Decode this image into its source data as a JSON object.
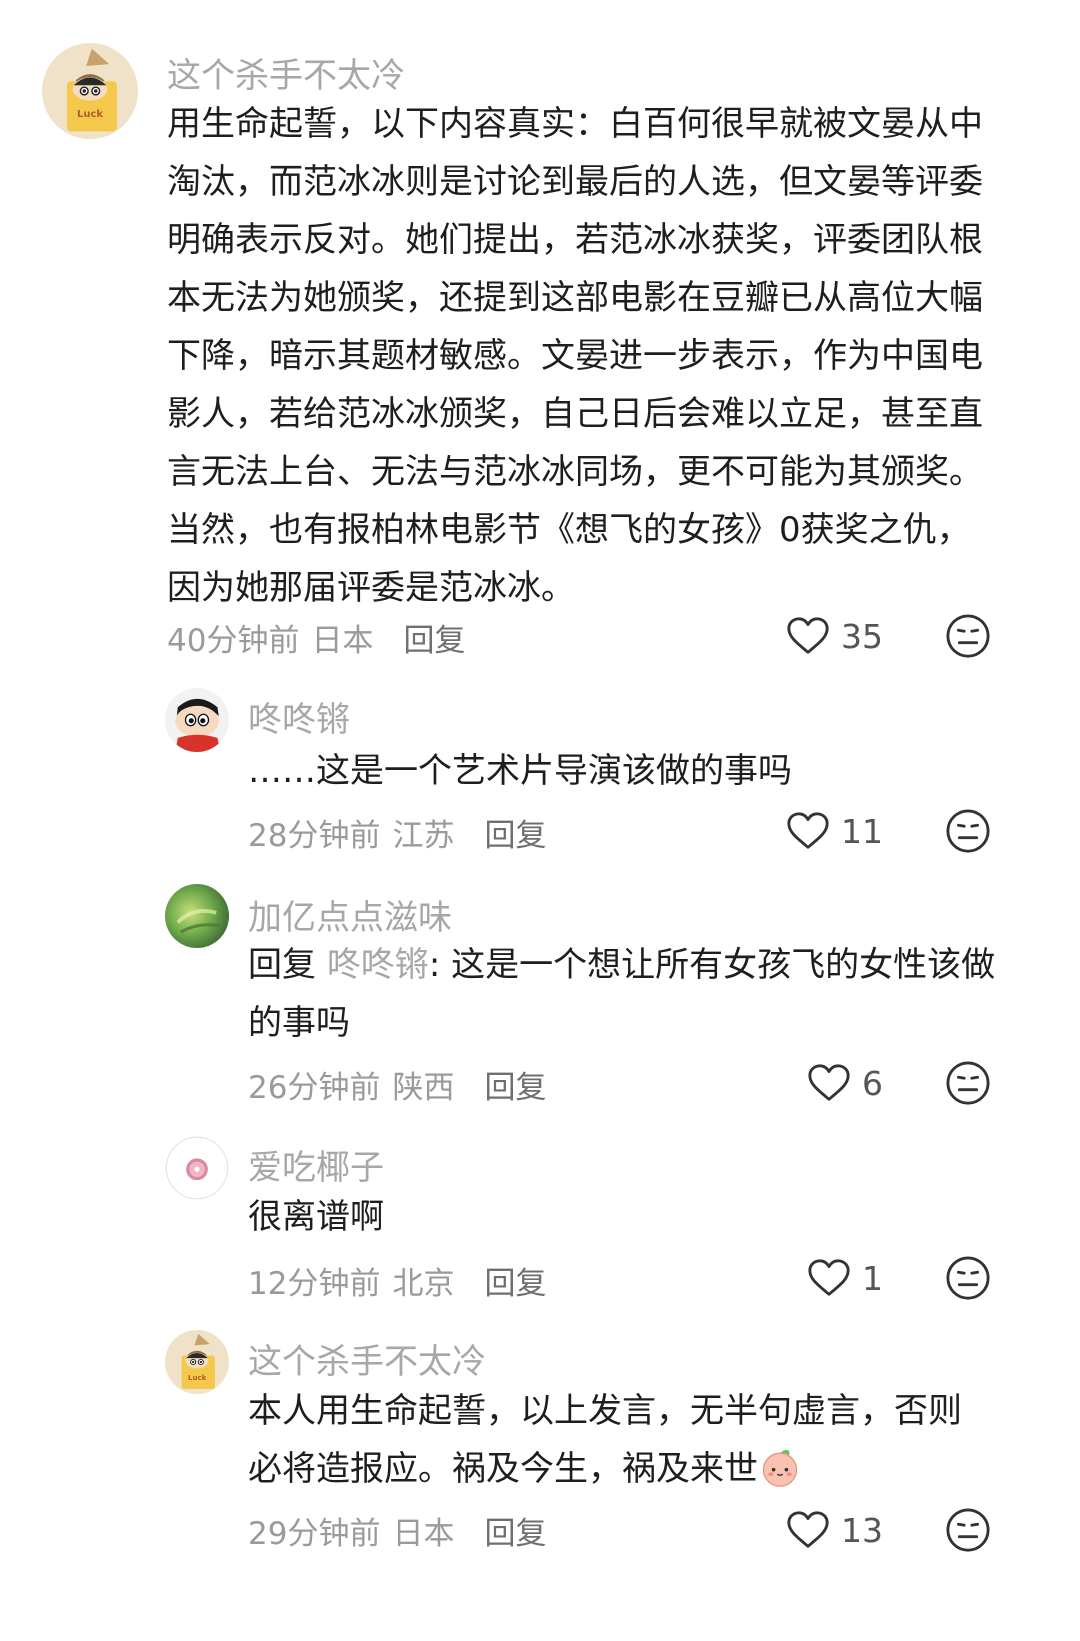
{
  "comments": [
    {
      "username": "这个杀手不太冷",
      "content": "用生命起誓，以下内容真实：白百何很早就被文晏从中淘汰，而范冰冰则是讨论到最后的人选，但文晏等评委明确表示反对。她们提出，若范冰冰获奖，评委团队根本无法为她颁奖，还提到这部电影在豆瓣已从高位大幅下降，暗示其题材敏感。文晏进一步表示，作为中国电影人，若给范冰冰颁奖，自己日后会难以立足，甚至直言无法上台、无法与范冰冰同场，更不可能为其颁奖。当然，也有报柏林电影节《想飞的女孩》0获奖之仇，因为她那届评委是范冰冰。",
      "time": "40分钟前",
      "location": "日本",
      "reply_label": "回复",
      "likes": "35",
      "avatar_icon": "crayon-shin-chan-bag-avatar",
      "avatar_bag_text": "Luck"
    }
  ],
  "replies": [
    {
      "username": "咚咚锵",
      "content": "……这是一个艺术片导演该做的事吗",
      "time": "28分钟前",
      "location": "江苏",
      "reply_label": "回复",
      "likes": "11",
      "avatar_icon": "crayon-shin-chan-avatar"
    },
    {
      "username": "加亿点点滋味",
      "reply_prefix": "回复 ",
      "reply_to": "咚咚锵",
      "content": ": 这是一个想让所有女孩飞的女性该做的事吗",
      "time": "26分钟前",
      "location": "陕西",
      "reply_label": "回复",
      "likes": "6",
      "avatar_icon": "green-plant-avatar"
    },
    {
      "username": "爱吃椰子",
      "content": "很离谱啊",
      "time": "12分钟前",
      "location": "北京",
      "reply_label": "回复",
      "likes": "1",
      "avatar_icon": "pink-donut-avatar"
    },
    {
      "username": "这个杀手不太冷",
      "content": "本人用生命起誓，以上发言，无半句虚言，否则必将造报应。祸及今生，祸及来世",
      "emoji": "peach-face-emoji",
      "time": "29分钟前",
      "location": "日本",
      "reply_label": "回复",
      "likes": "13",
      "avatar_icon": "crayon-shin-chan-bag-avatar",
      "avatar_bag_text": "Luck"
    }
  ],
  "icons": {
    "like": "heart-outline-icon",
    "dislike": "neutral-face-icon"
  },
  "colors": {
    "username": "#a7a7a7",
    "meta": "#9a9a9a",
    "text": "#1e1e1e"
  }
}
